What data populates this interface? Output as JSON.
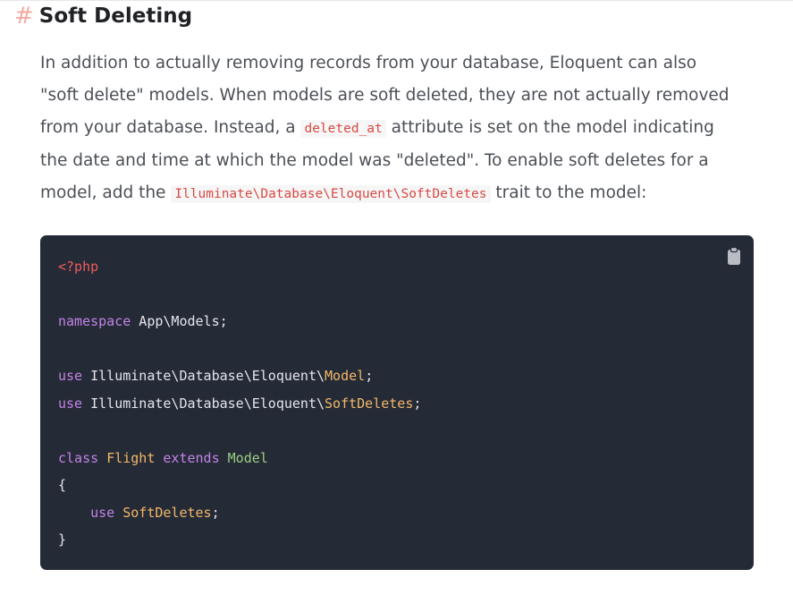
{
  "section": {
    "anchor": "#",
    "title": "Soft Deleting"
  },
  "paragraph": {
    "l1": "In addition to actually removing records from your database, Eloquent can also",
    "l2": "\"soft delete\" models. When models are soft deleted, they are not actually removed",
    "l3_pre": "from your database. Instead, a ",
    "l3_code": "deleted_at",
    "l3_post": " attribute is set on the model indicating",
    "l4": "the date and time at which the model was \"deleted\". To enable soft deletes for a",
    "l5_pre": "model, add the ",
    "l5_code": "Illuminate\\Database\\Eloquent\\SoftDeletes",
    "l5_post": " trait to the model:"
  },
  "code": {
    "copy_icon": "clipboard-icon",
    "open_tag": "<?php",
    "kw_namespace": "namespace",
    "ns_value": " App\\Models;",
    "kw_use": "use",
    "import_path": " Illuminate\\Database\\Eloquent\\",
    "import1_class": "Model",
    "import2_class": "SoftDeletes",
    "semicolon": ";",
    "kw_class": "class",
    "class_name": "Flight",
    "kw_extends": "extends",
    "parent_class": "Model",
    "open_brace": "{",
    "indent": "    ",
    "trait_name": "SoftDeletes",
    "close_brace": "}"
  },
  "colors": {
    "code_bg": "#252a37",
    "keyword": "#c384e6",
    "class": "#f2b867",
    "parent": "#9bcf82",
    "php_tag": "#ef5b5b",
    "inline_code": "#d84a44",
    "anchor": "#f2aaa0"
  }
}
